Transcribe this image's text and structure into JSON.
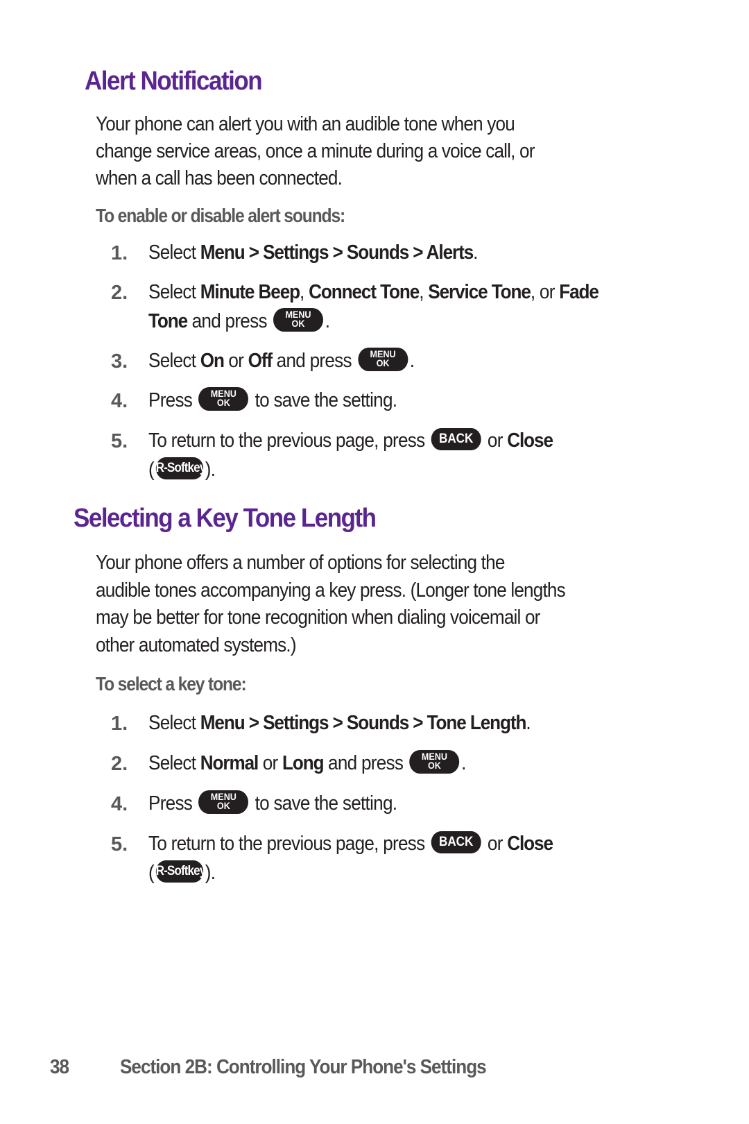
{
  "sections": [
    {
      "title": "Alert Notification",
      "intro_lines": [
        "Your phone can alert you with an audible tone when you",
        "change service areas, once a minute during a voice call, or",
        "when a call has been connected."
      ],
      "subhead": "To enable or disable alert sounds:",
      "steps": [
        {
          "num": "1.",
          "t1": "Select ",
          "b1": "Menu > Settings > Sounds > Alerts",
          "t2": "."
        },
        {
          "num": "2.",
          "t1": "Select ",
          "b1": "Minute Beep",
          "t2": ", ",
          "b2": "Connect Tone",
          "t3": ", ",
          "b3": "Service Tone",
          "t4": ", or ",
          "b4": "Fade",
          "line2_b": "Tone",
          "line2_t": " and press ",
          "line2_end": "."
        },
        {
          "num": "3.",
          "t1": "Select ",
          "b1": "On",
          "t2": " or ",
          "b2": "Off",
          "t3": " and press ",
          "t4": "."
        },
        {
          "num": "4.",
          "t1": "Press ",
          "t2": " to save the setting."
        },
        {
          "num": "5.",
          "t1": "To return to the previous page, press ",
          "t2": " or ",
          "b1": "Close",
          "line2_open": "(",
          "line2_close": ")."
        }
      ]
    },
    {
      "title": "Selecting a Key Tone Length",
      "intro_lines": [
        "Your phone offers a number of options for selecting the",
        "audible tones accompanying a key press. (Longer tone lengths",
        "may be better for tone recognition when dialing voicemail or",
        "other automated systems.)"
      ],
      "subhead": "To select a key tone:",
      "steps": [
        {
          "num": "1.",
          "t1": "Select ",
          "b1": "Menu > Settings > Sounds > Tone Length",
          "t2": "."
        },
        {
          "num": "2.",
          "t1": "Select ",
          "b1": "Normal",
          "t2": " or ",
          "b2": "Long",
          "t3": " and press ",
          "t4": "."
        },
        {
          "num": "4.",
          "t1": "Press ",
          "t2": " to save the setting."
        },
        {
          "num": "5.",
          "t1": "To return to the previous page, press ",
          "t2": " or ",
          "b1": "Close",
          "line2_open": "(",
          "line2_close": ")."
        }
      ]
    }
  ],
  "keys": {
    "menu_top": "MENU",
    "menu_bottom": "OK",
    "back": "BACK",
    "softkey": "R-Softkey"
  },
  "footer": {
    "page_number": "38",
    "section_title": "Section 2B: Controlling Your Phone's Settings"
  },
  "colors": {
    "heading": "#5a2590",
    "body_text": "#231f20",
    "subhead": "#58595b",
    "key_fill": "#231f20"
  }
}
